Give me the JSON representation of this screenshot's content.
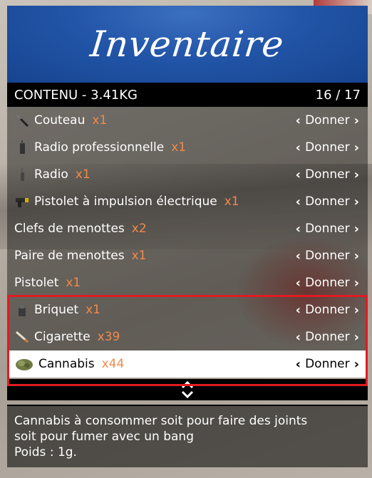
{
  "header": {
    "title": "Inventaire"
  },
  "subtitle": {
    "left": "CONTENU - 3.41KG",
    "right": "16 / 17"
  },
  "items": [
    {
      "name": "Couteau",
      "qty": "x1",
      "action": "Donner",
      "icon": "knife-icon"
    },
    {
      "name": "Radio professionnelle",
      "qty": "x1",
      "action": "Donner",
      "icon": "radio-icon"
    },
    {
      "name": "Radio",
      "qty": "x1",
      "action": "Donner",
      "icon": "radio-icon"
    },
    {
      "name": "Pistolet à impulsion électrique",
      "qty": "x1",
      "action": "Donner",
      "icon": "taser-icon"
    },
    {
      "name": "Clefs de menottes",
      "qty": "x2",
      "action": "Donner",
      "icon": ""
    },
    {
      "name": "Paire de menottes",
      "qty": "x1",
      "action": "Donner",
      "icon": ""
    },
    {
      "name": "Pistolet",
      "qty": "x1",
      "action": "Donner",
      "icon": ""
    },
    {
      "name": "Briquet",
      "qty": "x1",
      "action": "Donner",
      "icon": "lighter-icon"
    },
    {
      "name": "Cigarette",
      "qty": "x39",
      "action": "Donner",
      "icon": "cigarette-icon"
    },
    {
      "name": "Cannabis",
      "qty": "x44",
      "action": "Donner",
      "icon": "cannabis-icon"
    }
  ],
  "selected_index": 9,
  "description": {
    "line1": "Cannabis à consommer soit pour faire des joints",
    "line2": "soit pour fumer avec un bang",
    "line3": "Poids : 1g."
  },
  "colors": {
    "banner": "#2255a8",
    "quantity": "#f08a4b",
    "highlight": "#e01b22"
  }
}
